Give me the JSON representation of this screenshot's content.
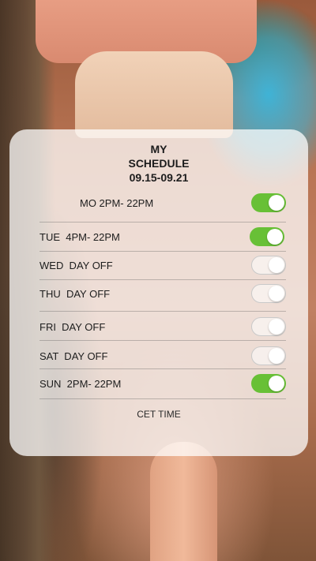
{
  "schedule": {
    "title_line1": "MY",
    "title_line2": "SCHEDULE",
    "date_range": "09.15-09.21",
    "days": [
      {
        "label": "MO 2PM- 22PM",
        "enabled": true
      },
      {
        "label": "TUE  4PM- 22PM",
        "enabled": true
      },
      {
        "label": "WED  DAY OFF",
        "enabled": false
      },
      {
        "label": "THU  DAY OFF",
        "enabled": false
      },
      {
        "label": "FRI  DAY OFF",
        "enabled": false
      },
      {
        "label": "SAT  DAY OFF",
        "enabled": false
      },
      {
        "label": "SUN  2PM- 22PM",
        "enabled": true
      }
    ],
    "timezone_note": "CET TIME"
  },
  "colors": {
    "toggle_on": "#68c036",
    "card_overlay": "rgba(255,255,255,0.74)"
  }
}
